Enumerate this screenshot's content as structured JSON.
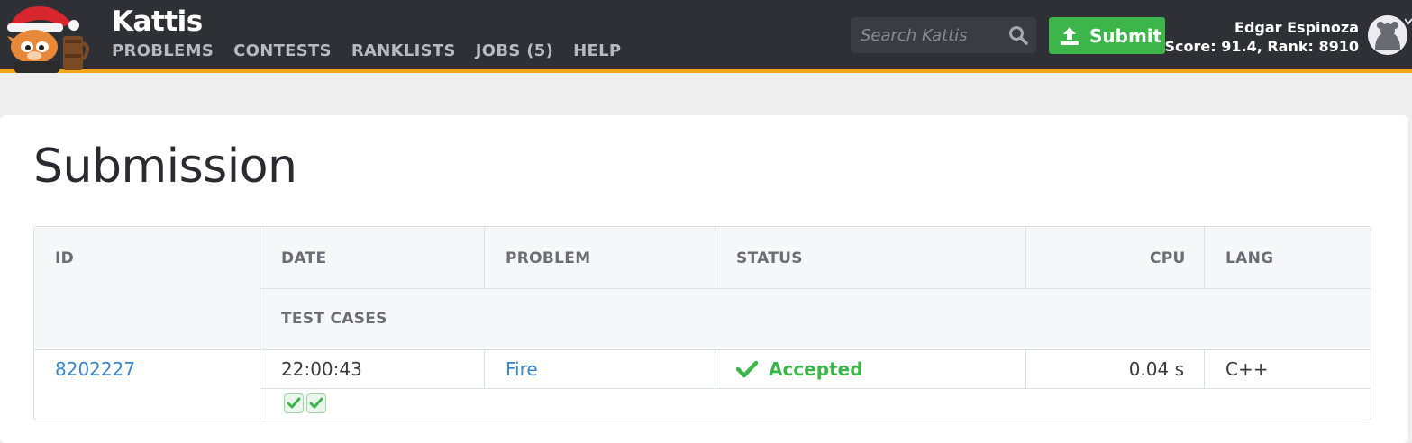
{
  "header": {
    "brand": "Kattis",
    "nav": [
      "PROBLEMS",
      "CONTESTS",
      "RANKLISTS",
      "JOBS (5)",
      "HELP"
    ],
    "search_placeholder": "Search Kattis",
    "submit_label": "Submit",
    "user_name": "Edgar Espinoza",
    "user_stats": "Score: 91.4, Rank: 8910"
  },
  "page": {
    "title": "Submission"
  },
  "table": {
    "headers": {
      "id": "ID",
      "date": "DATE",
      "problem": "PROBLEM",
      "status": "STATUS",
      "cpu": "CPU",
      "lang": "LANG",
      "test_cases": "TEST CASES"
    },
    "row": {
      "id": "8202227",
      "date": "22:00:43",
      "problem": "Fire",
      "status": "Accepted",
      "cpu": "0.04 s",
      "lang": "C++"
    },
    "test_cases_passed": 2
  },
  "colors": {
    "accent": "#f0a818",
    "success": "#3cb64a",
    "link": "#3b86c6",
    "header_bg": "#2f2f36"
  },
  "icons": [
    "kattis-cat-logo-icon",
    "search-icon",
    "upload-icon",
    "avatar-icon",
    "caret-down-icon",
    "check-icon"
  ]
}
